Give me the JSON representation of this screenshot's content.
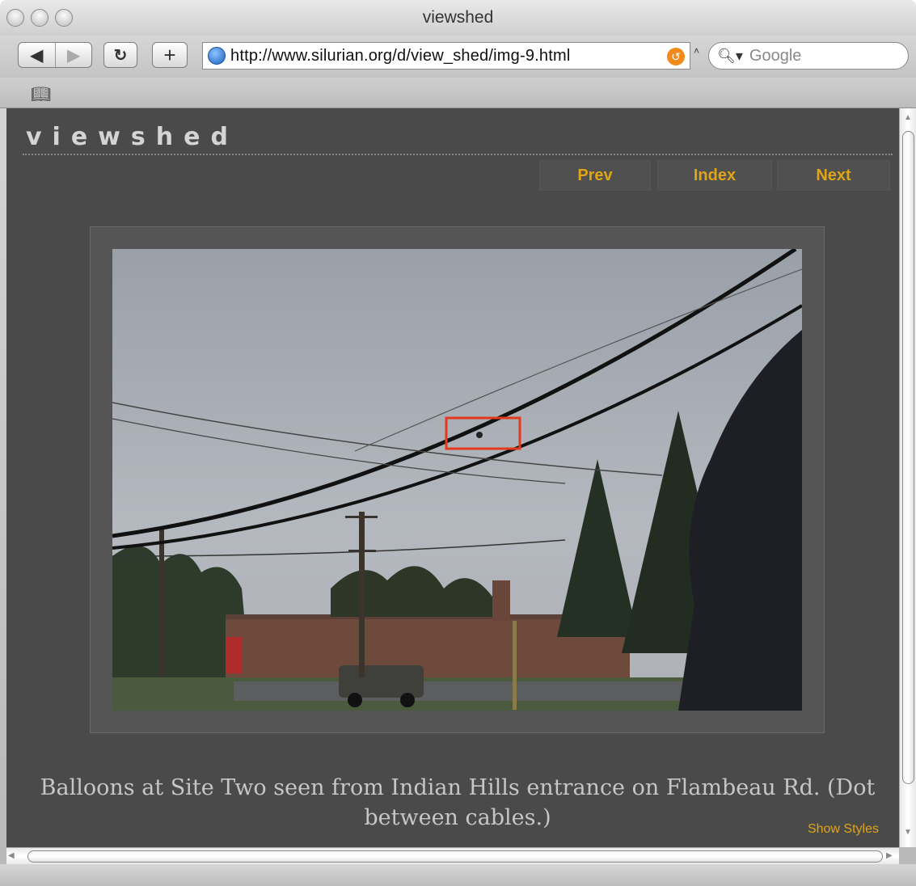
{
  "window": {
    "title": "viewshed"
  },
  "toolbar": {
    "back_icon": "back-arrow-icon",
    "forward_icon": "forward-arrow-icon",
    "reload_icon": "reload-icon",
    "add_icon": "plus-icon",
    "url": "http://www.silurian.org/d/view_shed/img-9.html",
    "search_placeholder": "Google"
  },
  "page": {
    "logo": "viewshed",
    "nav": {
      "prev": "Prev",
      "index": "Index",
      "next": "Next"
    },
    "caption": "Balloons at Site Two seen from Indian Hills entrance on Flambeau Rd. (Dot between cables.)",
    "show_styles": "Show Styles"
  },
  "colors": {
    "page_bg": "#4a4a4a",
    "link": "#e0a514",
    "highlight_box": "#e33a1e"
  }
}
